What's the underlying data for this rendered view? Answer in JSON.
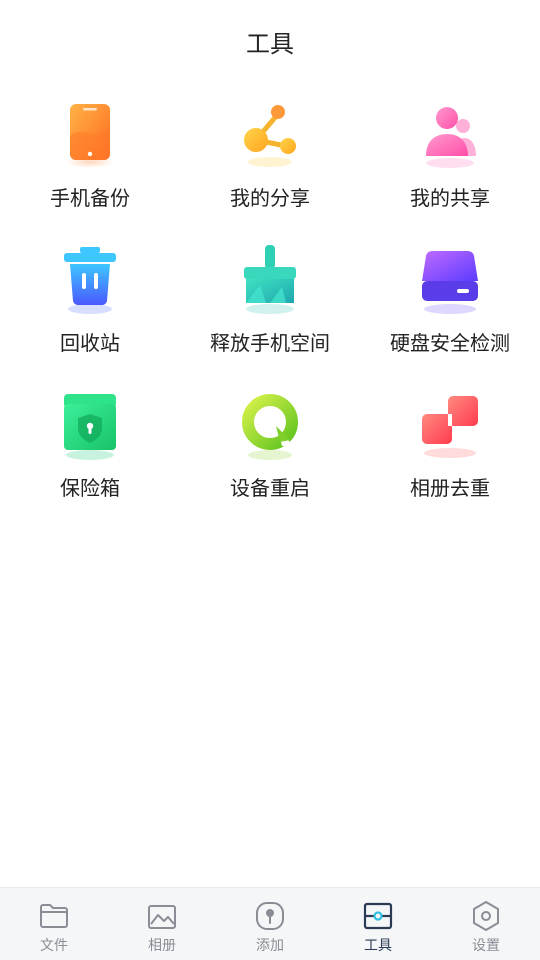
{
  "header": {
    "title": "工具"
  },
  "tools": [
    {
      "label": "手机备份",
      "icon": "phone-backup-icon"
    },
    {
      "label": "我的分享",
      "icon": "share-icon"
    },
    {
      "label": "我的共享",
      "icon": "shared-users-icon"
    },
    {
      "label": "回收站",
      "icon": "trash-bin-icon"
    },
    {
      "label": "释放手机空间",
      "icon": "broom-icon"
    },
    {
      "label": "硬盘安全检测",
      "icon": "hard-disk-icon"
    },
    {
      "label": "保险箱",
      "icon": "safe-box-icon"
    },
    {
      "label": "设备重启",
      "icon": "restart-icon"
    },
    {
      "label": "相册去重",
      "icon": "dedupe-photos-icon"
    }
  ],
  "tabbar": {
    "active": "工具",
    "tabs": [
      {
        "label": "文件",
        "icon": "folder-icon"
      },
      {
        "label": "相册",
        "icon": "image-icon"
      },
      {
        "label": "添加",
        "icon": "add-icon"
      },
      {
        "label": "工具",
        "icon": "tools-icon"
      },
      {
        "label": "设置",
        "icon": "settings-hex-icon"
      }
    ]
  },
  "colors": {
    "tab_active": "#2b3a55",
    "tab_inactive": "#8a8d95",
    "tab_background": "#f5f6f8"
  }
}
